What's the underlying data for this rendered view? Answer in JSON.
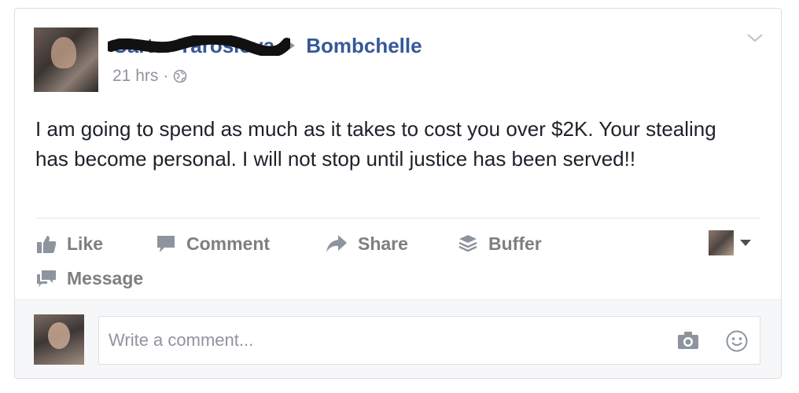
{
  "post": {
    "author_name": "Carter Yaroslova",
    "target_page": "Bombchelle",
    "timestamp": "21 hrs",
    "meta_separator": "·",
    "body": "I am going to spend as much as it takes to cost you over $2K. Your stealing has become personal. I will not stop until justice has been served!!"
  },
  "actions": {
    "like": "Like",
    "comment": "Comment",
    "share": "Share",
    "buffer": "Buffer",
    "message": "Message"
  },
  "comment_box": {
    "placeholder": "Write a comment..."
  },
  "icons": {
    "header": [
      "globe-icon",
      "chevron-down-icon",
      "arrow-right-icon"
    ],
    "actions": [
      "thumbs-up-icon",
      "speech-bubble-icon",
      "share-arrow-icon",
      "buffer-stack-icon",
      "message-icon",
      "caret-down-icon"
    ],
    "comment": [
      "camera-icon",
      "smiley-icon"
    ]
  },
  "colors": {
    "link": "#365899",
    "meta": "#90949c",
    "action_text": "#7f7f7f",
    "redaction": "#111111"
  }
}
